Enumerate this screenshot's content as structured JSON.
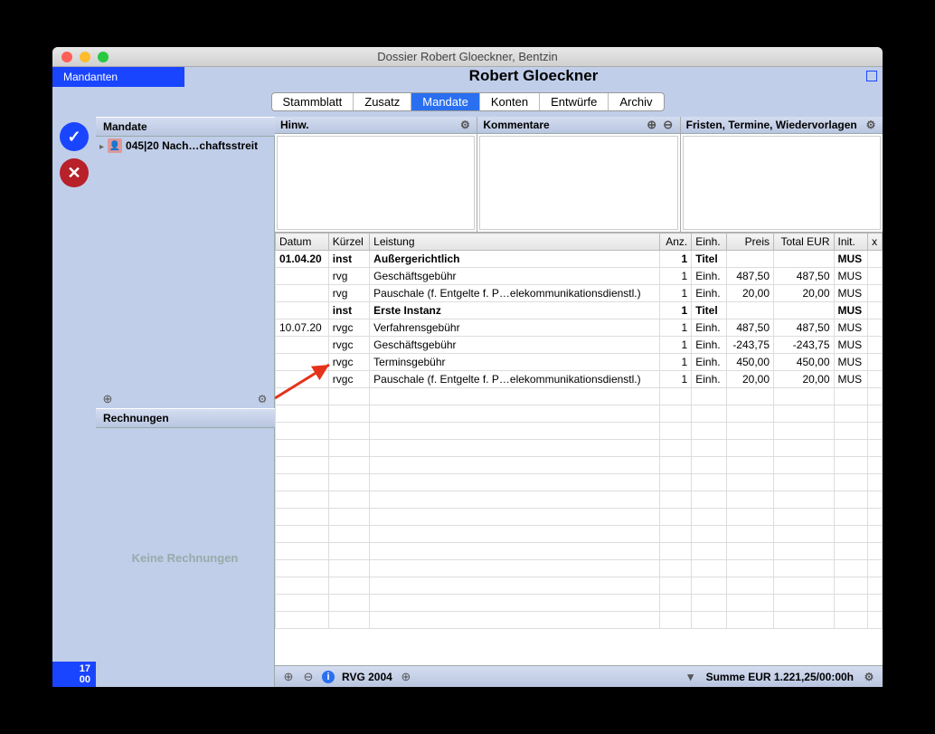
{
  "window": {
    "title": "Dossier Robert Gloeckner, Bentzin"
  },
  "topbar": {
    "mandanten": "Mandanten",
    "name": "Robert Gloeckner"
  },
  "tabs": [
    "Stammblatt",
    "Zusatz",
    "Mandate",
    "Konten",
    "Entwürfe",
    "Archiv"
  ],
  "activeTab": 2,
  "mandate": {
    "header": "Mandate",
    "item": "045|20 Nach…chaftsstreit",
    "rechnungen_header": "Rechnungen",
    "no_rechnungen": "Keine Rechnungen"
  },
  "panels": {
    "hinw": "Hinw.",
    "komm": "Kommentare",
    "frist": "Fristen, Termine, Wiedervorlagen"
  },
  "columns": [
    "Datum",
    "Kürzel",
    "Leistung",
    "Anz.",
    "Einh.",
    "Preis",
    "Total EUR",
    "Init.",
    "x"
  ],
  "rows": [
    {
      "datum": "01.04.20",
      "kurz": "inst",
      "leistung": "Außergerichtlich",
      "anz": "1",
      "einh": "Titel",
      "preis": "",
      "total": "",
      "init": "MUS",
      "bold": true
    },
    {
      "datum": "",
      "kurz": "rvg",
      "leistung": "Geschäftsgebühr",
      "anz": "1",
      "einh": "Einh.",
      "preis": "487,50",
      "total": "487,50",
      "init": "MUS"
    },
    {
      "datum": "",
      "kurz": "rvg",
      "leistung": "Pauschale (f. Entgelte f.  P…elekommunikationsdienstl.)",
      "anz": "1",
      "einh": "Einh.",
      "preis": "20,00",
      "total": "20,00",
      "init": "MUS"
    },
    {
      "datum": "",
      "kurz": "inst",
      "leistung": "Erste Instanz",
      "anz": "1",
      "einh": "Titel",
      "preis": "",
      "total": "",
      "init": "MUS",
      "bold": true
    },
    {
      "datum": "10.07.20",
      "kurz": "rvgc",
      "leistung": "Verfahrensgebühr",
      "anz": "1",
      "einh": "Einh.",
      "preis": "487,50",
      "total": "487,50",
      "init": "MUS"
    },
    {
      "datum": "",
      "kurz": "rvgc",
      "leistung": "Geschäftsgebühr",
      "anz": "1",
      "einh": "Einh.",
      "preis": "-243,75",
      "total": "-243,75",
      "init": "MUS"
    },
    {
      "datum": "",
      "kurz": "rvgc",
      "leistung": "Terminsgebühr",
      "anz": "1",
      "einh": "Einh.",
      "preis": "450,00",
      "total": "450,00",
      "init": "MUS"
    },
    {
      "datum": "",
      "kurz": "rvgc",
      "leistung": "Pauschale (f. Entgelte f.  P…elekommunikationsdienstl.)",
      "anz": "1",
      "einh": "Einh.",
      "preis": "20,00",
      "total": "20,00",
      "init": "MUS"
    }
  ],
  "status": {
    "rvg": "RVG 2004",
    "summe": "Summe EUR 1.221,25/00:00h"
  },
  "counter": {
    "t": "17",
    "b": "00"
  }
}
